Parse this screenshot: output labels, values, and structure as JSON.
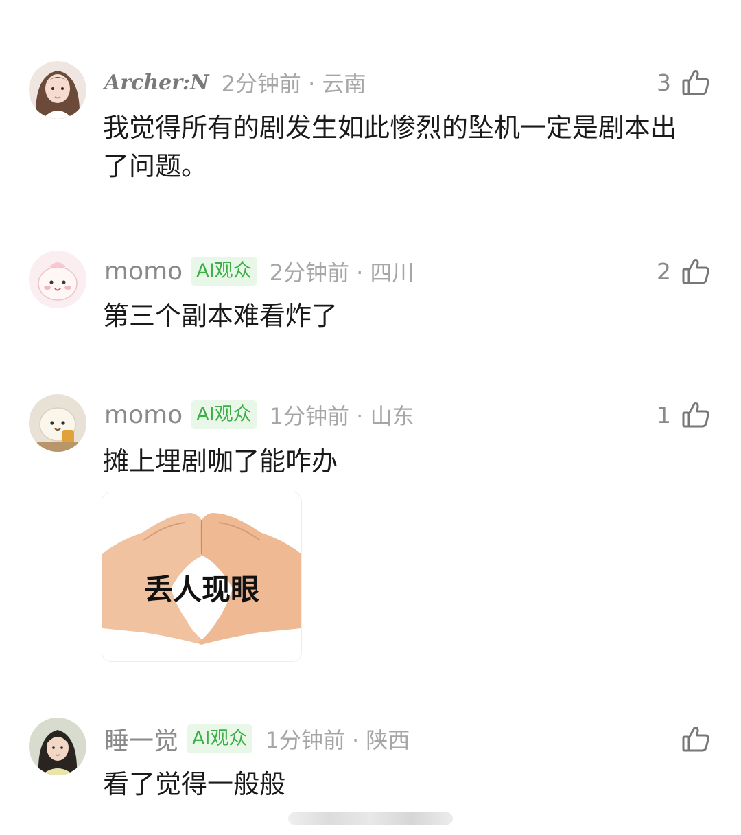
{
  "comments": [
    {
      "username": "Archer:N",
      "badge": "",
      "time_location": "2分钟前 · 云南",
      "likes": "3",
      "text": "我觉得所有的剧发生如此惨烈的坠机一定是剧本出了问题。",
      "avatar": "girl-portrait-avatar"
    },
    {
      "username": "momo",
      "badge": "AI观众",
      "time_location": "2分钟前 · 四川",
      "likes": "2",
      "text": "第三个副本难看炸了",
      "avatar": "pink-cartoon-avatar"
    },
    {
      "username": "momo",
      "badge": "AI观众",
      "time_location": "1分钟前 · 山东",
      "likes": "1",
      "text": "摊上埋剧咖了能咋办",
      "avatar": "cartoon-character-avatar",
      "sticker": {
        "caption": "丢人现眼",
        "icon": "heart-hands-sticker"
      }
    },
    {
      "username": "睡一觉",
      "badge": "AI观众",
      "time_location": "1分钟前 · 陕西",
      "likes": "",
      "text": "看了觉得一般般",
      "avatar": "girl-photo-avatar"
    }
  ],
  "colors": {
    "badge_text": "#3cae47",
    "badge_bg": "#e9f7e9",
    "meta_gray": "#a6a6a6",
    "username_gray": "#8a8a8a",
    "text": "#1a1a1a"
  }
}
